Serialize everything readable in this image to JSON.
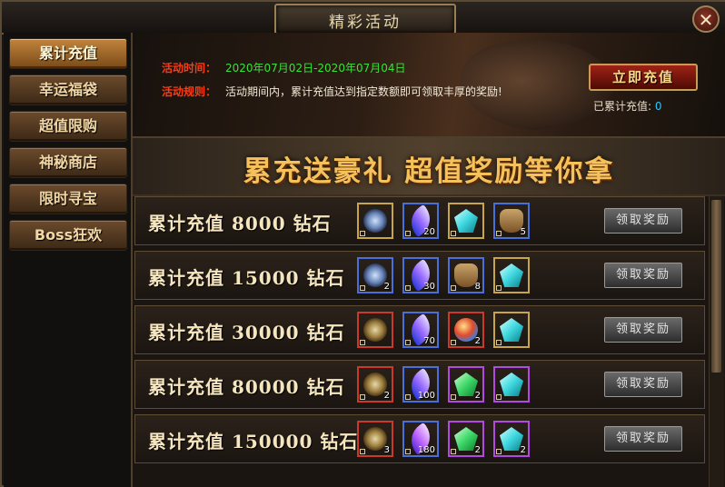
{
  "window": {
    "title": "精彩活动",
    "close_symbol": "✕"
  },
  "sidebar": {
    "items": [
      {
        "label": "累计充值",
        "active": true
      },
      {
        "label": "幸运福袋",
        "active": false
      },
      {
        "label": "超值限购",
        "active": false
      },
      {
        "label": "神秘商店",
        "active": false
      },
      {
        "label": "限时寻宝",
        "active": false
      },
      {
        "label": "Boss狂欢",
        "active": false
      }
    ]
  },
  "banner": {
    "time_label": "活动时间：",
    "time_value": "2020年07月02日-2020年07月04日",
    "rule_label": "活动规则：",
    "rule_value": "活动期间内，累计充值达到指定数额即可领取丰厚的奖励!",
    "recharge_button": "立即充值",
    "total_label": "已累计充值: ",
    "total_value": "0"
  },
  "headline": "累充送豪礼   超值奖励等你拿",
  "rows": [
    {
      "label": "累计充值  8000  钻石",
      "claim": "领取奖励",
      "items": [
        {
          "icon": "coin-icon",
          "frame": "gold",
          "count": ""
        },
        {
          "icon": "feather-icon",
          "frame": "blue",
          "count": "20"
        },
        {
          "icon": "crystal-icon",
          "frame": "gold",
          "count": ""
        },
        {
          "icon": "pouch-icon",
          "frame": "blue",
          "count": "5"
        }
      ]
    },
    {
      "label": "累计充值  15000  钻石",
      "claim": "领取奖励",
      "items": [
        {
          "icon": "coin-icon",
          "frame": "blue",
          "count": "2"
        },
        {
          "icon": "feather-icon",
          "frame": "blue",
          "count": "30"
        },
        {
          "icon": "pouch-icon",
          "frame": "blue",
          "count": "8"
        },
        {
          "icon": "crystal-icon",
          "frame": "gold",
          "count": ""
        }
      ]
    },
    {
      "label": "累计充值  30000  钻石",
      "claim": "领取奖励",
      "items": [
        {
          "icon": "medallion-icon",
          "frame": "red",
          "count": ""
        },
        {
          "icon": "feather-icon",
          "frame": "blue",
          "count": "70"
        },
        {
          "icon": "orb-icon",
          "frame": "red",
          "count": "2"
        },
        {
          "icon": "crystal-icon",
          "frame": "gold",
          "count": ""
        }
      ]
    },
    {
      "label": "累计充值  80000  钻石",
      "claim": "领取奖励",
      "items": [
        {
          "icon": "medallion-icon",
          "frame": "red",
          "count": "2"
        },
        {
          "icon": "feather-icon",
          "frame": "blue",
          "count": "100"
        },
        {
          "icon": "gem-green-icon",
          "frame": "purple",
          "count": "2"
        },
        {
          "icon": "crystal-icon",
          "frame": "purple",
          "count": ""
        }
      ]
    },
    {
      "label": "累计充值 150000 钻石",
      "claim": "领取奖励",
      "items": [
        {
          "icon": "medallion-icon",
          "frame": "red",
          "count": "3"
        },
        {
          "icon": "feather-purple-icon",
          "frame": "blue",
          "count": "180"
        },
        {
          "icon": "gem-green-icon",
          "frame": "purple",
          "count": "2"
        },
        {
          "icon": "crystal-icon",
          "frame": "purple",
          "count": "2"
        }
      ]
    }
  ],
  "colors": {
    "accent_gold": "#f5c15a",
    "label_red": "#ff3a12",
    "date_green": "#38e23a",
    "rule_white": "#f2ead6",
    "value_blue": "#27c7ff"
  }
}
